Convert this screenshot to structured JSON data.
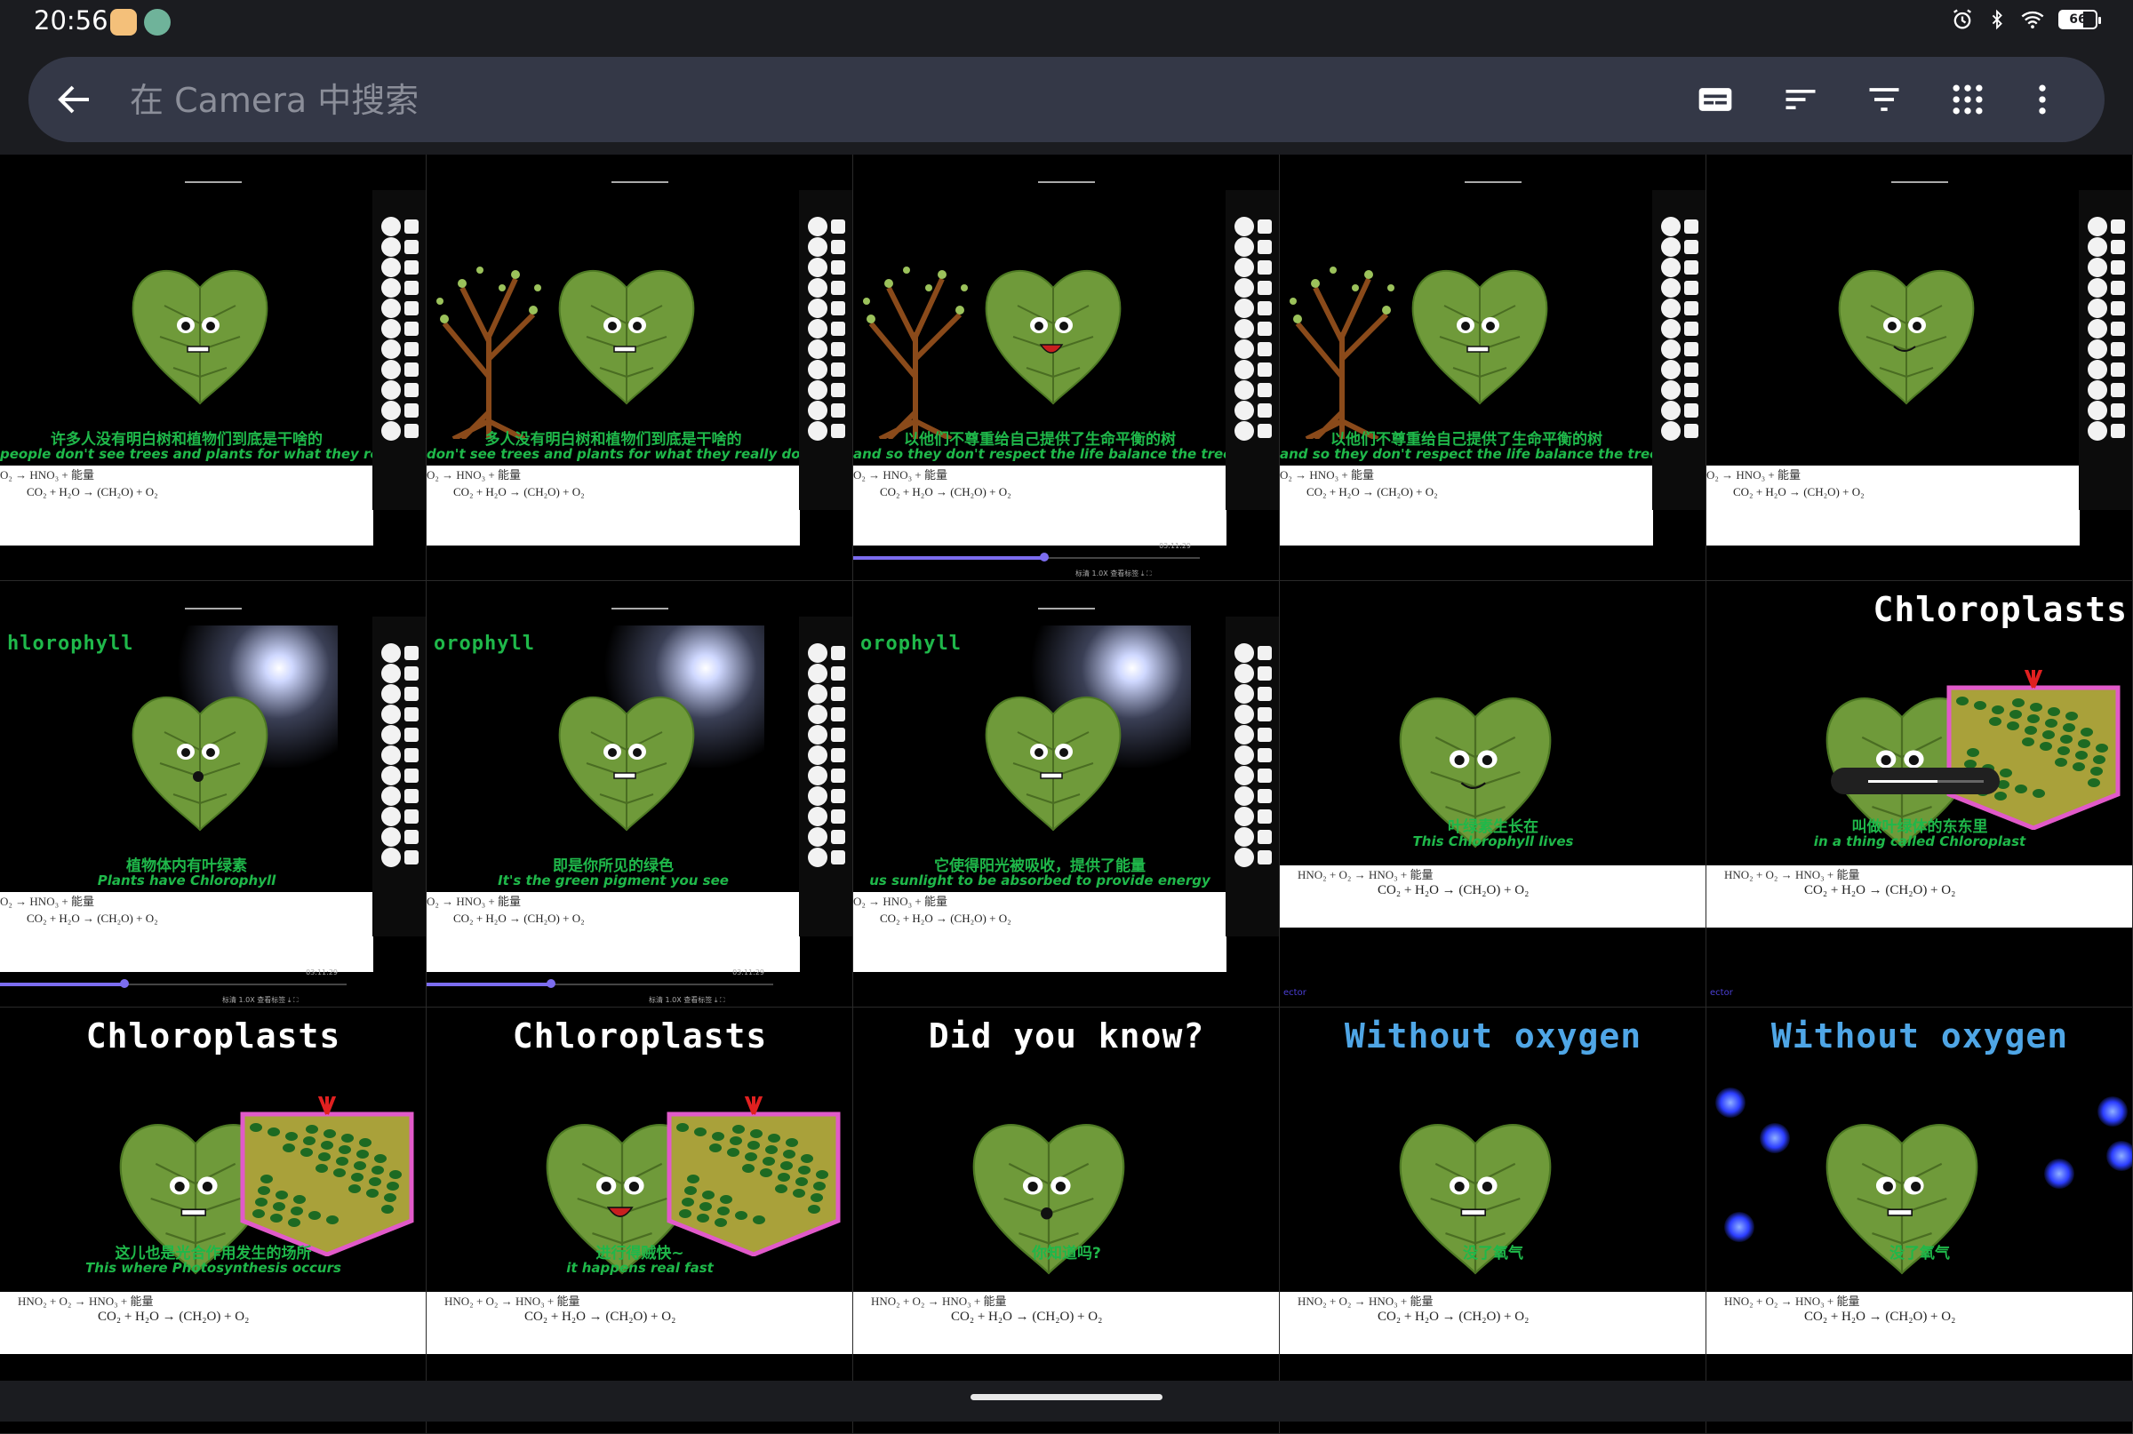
{
  "status_bar": {
    "time": "20:56",
    "battery": 66,
    "battery_label": "66",
    "icons": [
      "alarm-icon",
      "bluetooth-icon",
      "wifi-icon",
      "battery-icon"
    ]
  },
  "search": {
    "placeholder": "在 Camera 中搜索",
    "value": ""
  },
  "toolbar": {
    "buttons": [
      "subtitles-icon",
      "sort-icon",
      "filter-icon",
      "grid-view-icon",
      "more-vert-icon"
    ]
  },
  "colors": {
    "leaf_green": "#6f9a3a",
    "subtitle_green": "#1fb84a",
    "progress_purple": "#7c6df0",
    "heading_blue": "#4fa6e6"
  },
  "thumbnails": [
    {
      "sub_cn": "许多人没有明白树和植物们到底是干啥的",
      "sub_en": "people don't see trees and plants for what they really do",
      "formula_top": "O₂ → HNO₃ + 能量",
      "formula": "CO₂ + H₂O → (CH₂O) + O₂"
    },
    {
      "sub_cn": "多人没有明白树和植物们到底是干啥的",
      "sub_en": "don't see trees and plants for what they really do",
      "formula_top": "O₂ → HNO₃ + 能量",
      "formula": "CO₂ + H₂O → (CH₂O) + O₂"
    },
    {
      "sub_cn": "以他们不尊重给自己提供了生命平衡的树",
      "sub_en": "and so they don't respect the life balance the trees provide for you",
      "formula_top": "O₂ → HNO₃ + 能量",
      "formula": "CO₂ + H₂O → (CH₂O) + O₂",
      "progress": 0.55,
      "time": "03:11:29",
      "ctrls": "标清   1.0X   查看标签   ⤓   ⛶"
    },
    {
      "sub_cn": "以他们不尊重给自己提供了生命平衡的树",
      "sub_en": "and so they don't respect the life balance the trees provide for you",
      "formula_top": "O₂ → HNO₃ + 能量",
      "formula": "CO₂ + H₂O → (CH₂O) + O₂"
    },
    {
      "sub_cn": "",
      "sub_en": "",
      "formula_top": "O₂ → HNO₃ + 能量",
      "formula": "CO₂ + H₂O → (CH₂O) + O₂"
    },
    {
      "heading": "hlorophyll",
      "sub_cn": "植物体内有叶绿素",
      "sub_en": "Plants have Chlorophyll",
      "formula_top": "O₂ → HNO₃ + 能量",
      "formula": "CO₂ + H₂O → (CH₂O) + O₂",
      "progress": 0.36,
      "time": "03:11:29",
      "ctrls": "标清   1.0X   查看标签   ⤓   ⛶"
    },
    {
      "heading": "orophyll",
      "sub_cn": "即是你所见的绿色",
      "sub_en": "It's the green pigment you see",
      "formula_top": "O₂ → HNO₃ + 能量",
      "formula": "CO₂ + H₂O → (CH₂O) + O₂",
      "progress": 0.36,
      "time": "03:11:29",
      "ctrls": "标清   1.0X   查看标签   ⤓   ⛶"
    },
    {
      "heading": "orophyll",
      "sub_cn": "它使得阳光被吸收，提供了能量",
      "sub_en": "us sunlight to be absorbed to provide energy",
      "formula_top": "O₂ → HNO₃ + 能量",
      "formula": "CO₂ + H₂O → (CH₂O) + O₂"
    },
    {
      "sub_cn": "叶绿素生长在",
      "sub_en": "This Chlorophyll lives",
      "formula_top": "HNO₂ + O₂ → HNO₃ + 能量",
      "formula": "CO₂ + H₂O → (CH₂O) + O₂",
      "corner": "ector"
    },
    {
      "heading": "Chloroplasts",
      "sub_cn": "叫做叶绿体的东东里",
      "sub_en": "in a thing called Chloroplast",
      "formula_top": "HNO₂ + O₂ → HNO₃ + 能量",
      "formula": "CO₂ + H₂O → (CH₂O) + O₂",
      "corner": "ector",
      "volume": 0.6
    },
    {
      "heading": "Chloroplasts",
      "sub_cn": "这儿也是光合作用发生的场所",
      "sub_en": "This where Photosynthesis occurs",
      "formula_top": "HNO₂ + O₂ → HNO₃ + 能量",
      "formula": "CO₂ + H₂O → (CH₂O) + O₂"
    },
    {
      "heading": "Chloroplasts",
      "sub_cn": "进行得贼快~",
      "sub_en": "it happens real fast",
      "formula_top": "HNO₂ + O₂ → HNO₃ + 能量",
      "formula": "CO₂ + H₂O → (CH₂O) + O₂"
    },
    {
      "heading": "Did you know?",
      "sub_cn": "你知道吗?",
      "sub_en": "",
      "formula_top": "HNO₂ + O₂ → HNO₃ + 能量",
      "formula": "CO₂ + H₂O → (CH₂O) + O₂"
    },
    {
      "heading": "Without oxygen",
      "sub_cn": "没了氧气",
      "sub_en": "",
      "formula_top": "HNO₂ + O₂ → HNO₃ + 能量",
      "formula": "CO₂ + H₂O → (CH₂O) + O₂"
    },
    {
      "heading": "Without oxygen",
      "sub_cn": "没了氧气",
      "sub_en": "",
      "formula_top": "HNO₂ + O₂ → HNO₃ + 能量",
      "formula": "CO₂ + H₂O → (CH₂O) + O₂"
    }
  ]
}
